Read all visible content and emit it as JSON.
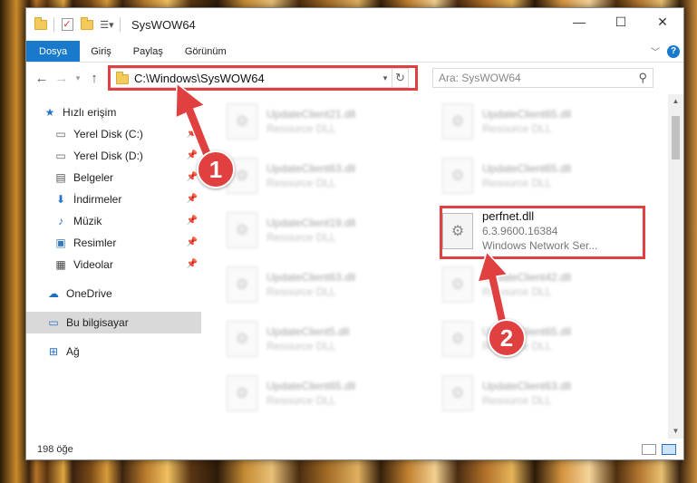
{
  "window": {
    "title": "SysWOW64",
    "controls": {
      "minimize": "—",
      "maximize": "☐",
      "close": "✕"
    }
  },
  "ribbon": {
    "tabs": [
      {
        "label": "Dosya",
        "active": true
      },
      {
        "label": "Giriş"
      },
      {
        "label": "Paylaş"
      },
      {
        "label": "Görünüm"
      }
    ]
  },
  "address": {
    "path": "C:\\Windows\\SysWOW64",
    "search_placeholder": "Ara: SysWOW64"
  },
  "sidebar": {
    "items": [
      {
        "label": "Hızlı erişim",
        "icon": "star-icon"
      },
      {
        "label": "Yerel Disk (C:)",
        "icon": "drive-icon",
        "pinned": true
      },
      {
        "label": "Yerel Disk (D:)",
        "icon": "drive-icon",
        "pinned": true
      },
      {
        "label": "Belgeler",
        "icon": "documents-icon",
        "pinned": true
      },
      {
        "label": "İndirmeler",
        "icon": "download-icon",
        "pinned": true
      },
      {
        "label": "Müzik",
        "icon": "music-icon",
        "pinned": true
      },
      {
        "label": "Resimler",
        "icon": "pictures-icon",
        "pinned": true
      },
      {
        "label": "Videolar",
        "icon": "videos-icon",
        "pinned": true
      },
      {
        "label": "OneDrive",
        "icon": "cloud-icon"
      },
      {
        "label": "Bu bilgisayar",
        "icon": "computer-icon",
        "selected": true
      },
      {
        "label": "Ağ",
        "icon": "network-icon"
      }
    ]
  },
  "files": {
    "left": [
      {
        "name": "UpdateClient21.dll",
        "type": "Resource DLL"
      },
      {
        "name": "UpdateClient63.dll",
        "type": "Resource DLL"
      },
      {
        "name": "UpdateClient19.dll",
        "type": "Resource DLL"
      },
      {
        "name": "UpdateClient63.dll",
        "type": "Resource DLL"
      },
      {
        "name": "UpdateClient5.dll",
        "type": "Resource DLL"
      },
      {
        "name": "UpdateClient65.dll",
        "type": "Resource DLL"
      }
    ],
    "right": [
      {
        "name": "UpdateClient65.dll",
        "type": "Resource DLL"
      },
      {
        "name": "UpdateClient65.dll",
        "type": "Resource DLL"
      },
      {
        "name": "perfnet.dll",
        "version": "6.3.9600.16384",
        "type": "Windows Network Ser...",
        "highlighted": true
      },
      {
        "name": "UpdateClient42.dll",
        "type": "Resource DLL"
      },
      {
        "name": "UpdateClient65.dll",
        "type": "Resource DLL"
      },
      {
        "name": "UpdateClient63.dll",
        "type": "Resource DLL"
      }
    ]
  },
  "status": {
    "item_count": "198 öğe"
  },
  "callouts": [
    {
      "number": "1"
    },
    {
      "number": "2"
    }
  ],
  "colors": {
    "accent": "#1979ca",
    "callout": "#e0403f"
  }
}
